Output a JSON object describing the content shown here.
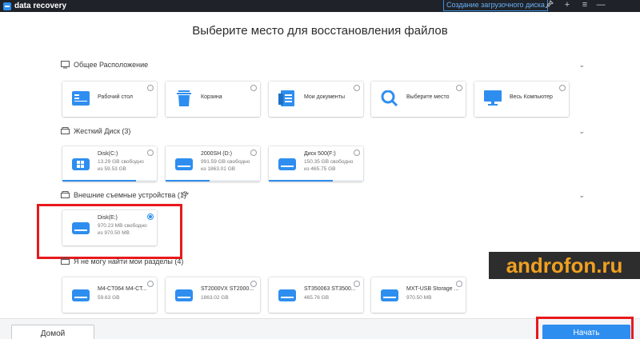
{
  "app": {
    "title": "data recovery",
    "create_boot_disk": "Создание загрузочного диска",
    "icons": [
      "pin-icon",
      "plus-icon",
      "menu-icon",
      "minimize-icon"
    ]
  },
  "page_title": "Выберите место для восстановления файлов",
  "sections": {
    "common": {
      "label": "Общее Расположение",
      "items": [
        {
          "label": "Рабочий стол",
          "icon": "desktop-icon"
        },
        {
          "label": "Корзина",
          "icon": "trash-icon"
        },
        {
          "label": "Мои документы",
          "icon": "documents-icon"
        },
        {
          "label": "Выберите место",
          "icon": "search-icon"
        },
        {
          "label": "Весь Компьютер",
          "icon": "computer-icon"
        }
      ]
    },
    "hard_disk": {
      "label": "Жесткий Диск (3)",
      "drives": [
        {
          "name": "Disk(C:)",
          "line1": "13.29 GB  свободно",
          "line2": "из    59.53 GB",
          "used_fraction": 0.78
        },
        {
          "name": "2000SH (D:)",
          "line1": "991.59 GB  свободно",
          "line2": "из    1863.01 GB",
          "used_fraction": 0.47
        },
        {
          "name": "Диск 500(F:)",
          "line1": "150.35 GB  свободно",
          "line2": "из    465.75 GB",
          "used_fraction": 0.68
        }
      ]
    },
    "external": {
      "label": "Внешние съемные устройства (1)",
      "drives": [
        {
          "name": "Disk(E:)",
          "line1": "970.23 MB  свободно",
          "line2": "из    970.50 MB",
          "selected": true
        }
      ]
    },
    "lost": {
      "label": "Я не могу найти мои разделы (4)",
      "drives": [
        {
          "name": "M4-CT064 M4-CT...",
          "size": "59.63 GB"
        },
        {
          "name": "ST2000VX ST2000...",
          "size": "1863.02 GB"
        },
        {
          "name": "ST350063 ST3500...",
          "size": "465.76 GB"
        },
        {
          "name": "MXT-USB Storage ...",
          "size": "970.50 MB"
        }
      ]
    }
  },
  "footer": {
    "home_label": "Домой",
    "start_label": "Начать"
  },
  "watermark": "androfon.ru",
  "colors": {
    "accent": "#2e8ef0",
    "highlight": "#e8191c",
    "titlebar": "#1f2329"
  }
}
